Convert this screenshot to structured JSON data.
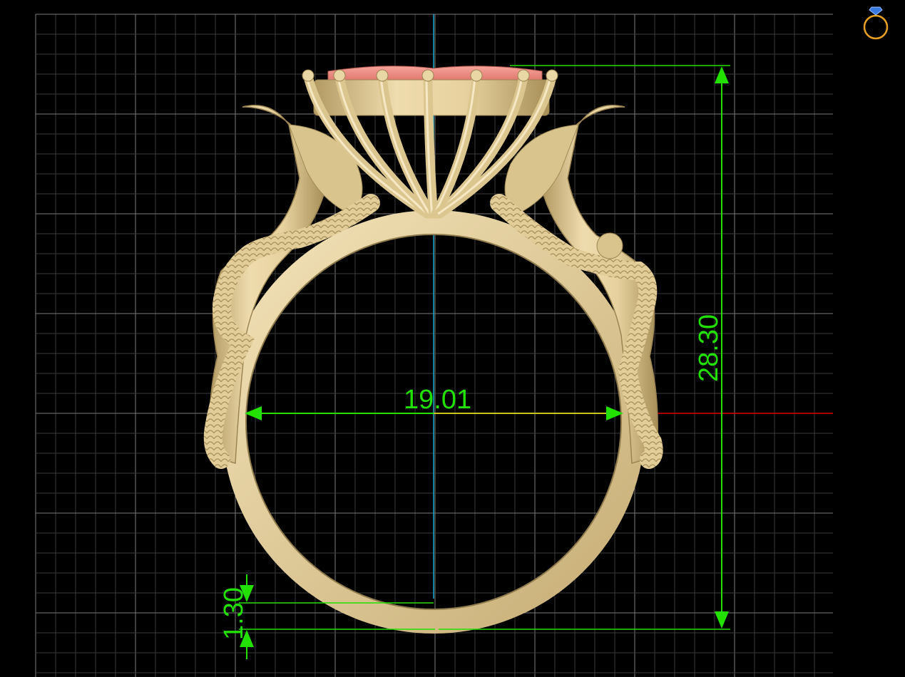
{
  "viewport": {
    "background_color": "#000000",
    "grid_minor_color": "#3a3a3a",
    "grid_major_color": "#7a7a7a",
    "axis_vertical_color": "#1aa8c8",
    "axis_horizontal_color": "#e00000"
  },
  "model": {
    "metal_color": "#e9d6a6",
    "metal_shadow_color": "#b39a63",
    "stone_color": "#f08a80"
  },
  "dimensions": {
    "color": "#22e000",
    "inner_diameter": "19.01",
    "overall_height": "28.30",
    "shank_thickness": "1.30"
  },
  "corner_icon": {
    "name": "ring-view-icon",
    "ring_color": "#e8a020",
    "gem_color": "#3a7ae0"
  }
}
